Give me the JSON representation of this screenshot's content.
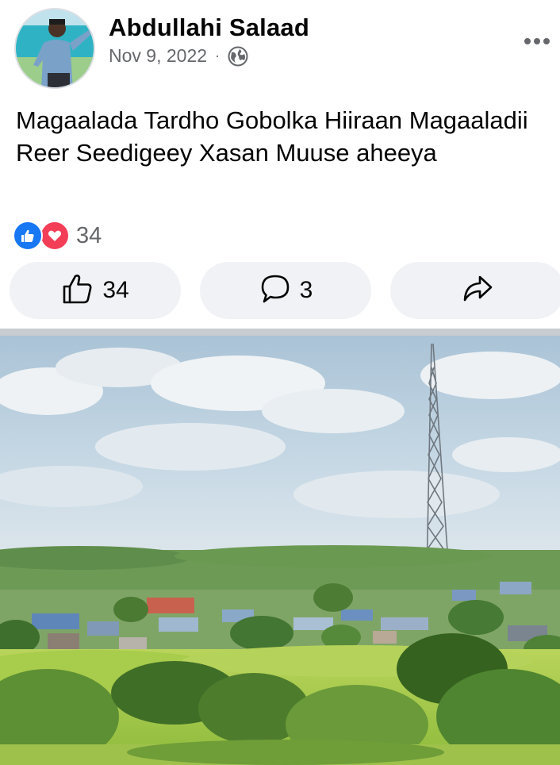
{
  "post": {
    "author_name": "Abdullahi Salaad",
    "date": "Nov 9, 2022",
    "separator": "·",
    "privacy_icon": "globe-icon",
    "more_icon": "more-options-icon",
    "text": "Magaalada Tardho Gobolka Hiiraan Magaaladii Reer Seedigeey Xasan Muuse aheeya"
  },
  "reactions": {
    "icons": [
      "like-reaction-icon",
      "love-reaction-icon"
    ],
    "count": "34"
  },
  "actions": {
    "like": {
      "icon": "thumbs-up-icon",
      "label": "34"
    },
    "comment": {
      "icon": "comment-bubble-icon",
      "label": "3"
    },
    "share": {
      "icon": "share-arrow-icon",
      "label": ""
    }
  },
  "colors": {
    "accent_like": "#1877f2",
    "accent_love": "#f33e58",
    "text_primary": "#050505",
    "text_secondary": "#65676b",
    "button_bg": "#f0f2f5",
    "divider": "#c9ccd1"
  }
}
